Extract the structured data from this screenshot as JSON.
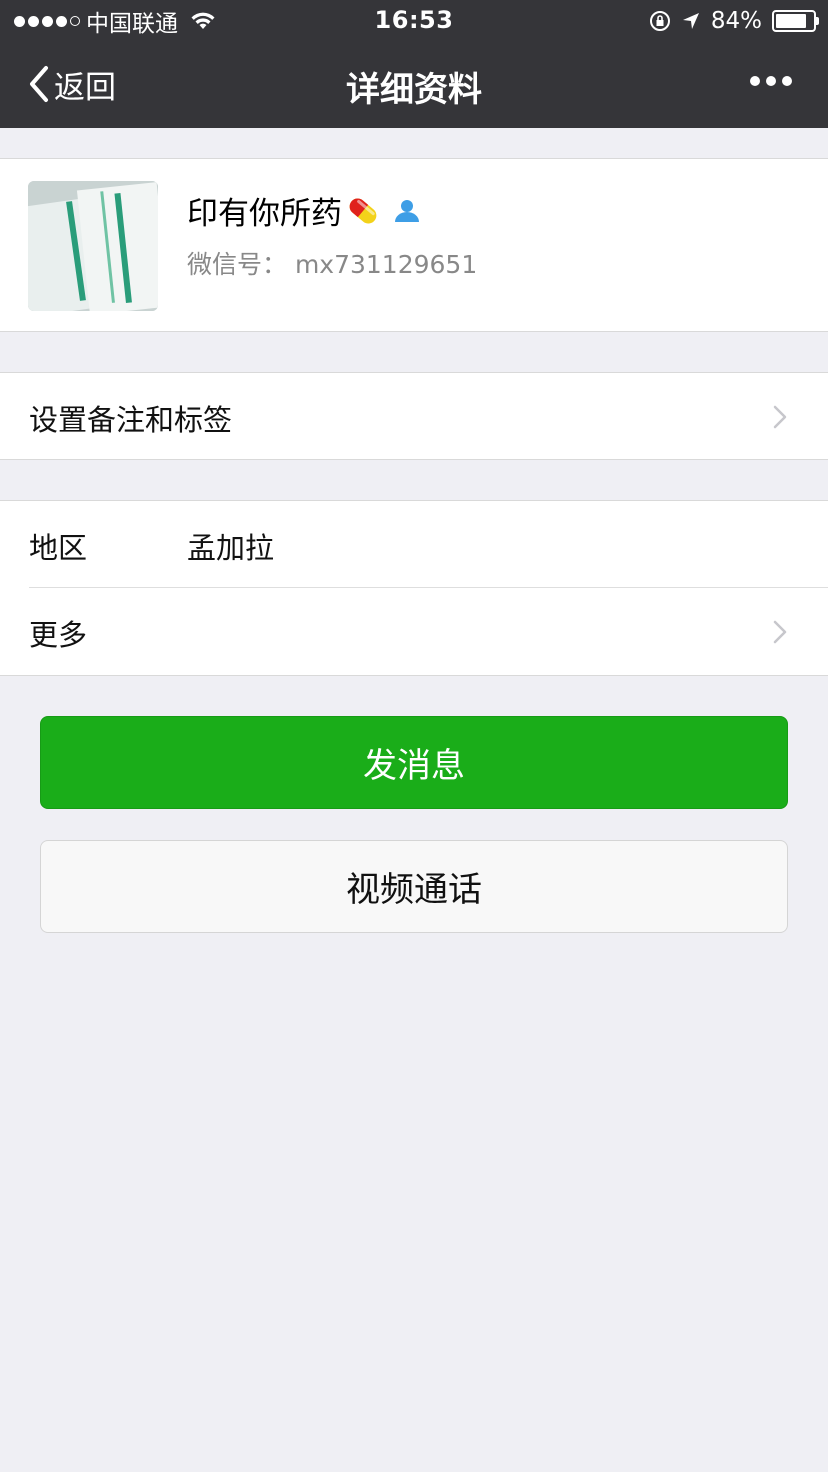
{
  "status_bar": {
    "signal_filled": 4,
    "signal_total": 5,
    "carrier": "中国联通",
    "time": "16:53",
    "battery": "84%",
    "battery_level": 0.84
  },
  "nav": {
    "back_label": "返回",
    "title": "详细资料"
  },
  "profile": {
    "nickname": "印有你所药",
    "wechat_id": "微信号：  mx731129651"
  },
  "cells": {
    "remark_label": "设置备注和标签",
    "region_label": "地区",
    "region_value": "孟加拉",
    "more_label": "更多"
  },
  "actions": {
    "send_message": "发消息",
    "video_call": "视频通话"
  },
  "colors": {
    "nav_bg": "#353539",
    "page_bg": "#efeff4",
    "primary_green": "#1aad19"
  }
}
